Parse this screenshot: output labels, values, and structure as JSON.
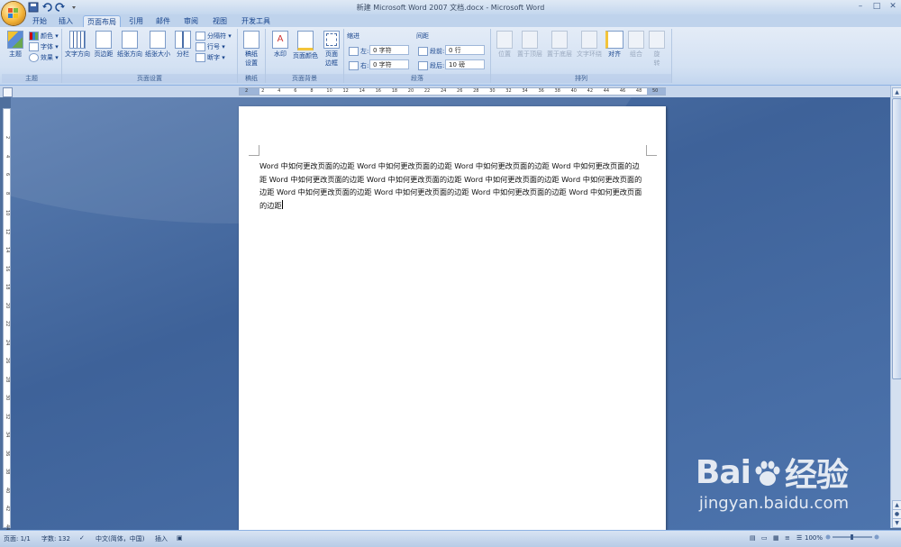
{
  "window": {
    "title": "新建 Microsoft Word 2007 文档.docx - Microsoft Word",
    "controls": [
      "–",
      "□",
      "✕"
    ]
  },
  "tabs": [
    "开始",
    "插入",
    "页面布局",
    "引用",
    "邮件",
    "审阅",
    "视图",
    "开发工具"
  ],
  "active_tab": "页面布局",
  "ribbon": {
    "theme_group": {
      "label": "主题",
      "theme_button": "主题",
      "colors": "颜色 ▾",
      "fonts": "字体 ▾",
      "effects": "效果 ▾"
    },
    "page_setup": {
      "label": "页面设置",
      "text_direction": "文字方向",
      "margins": "页边距",
      "orientation": "纸张方向",
      "size": "纸张大小",
      "columns": "分栏",
      "breaks": "分隔符 ▾",
      "line_numbers": "行号 ▾",
      "hyphenation": "断字 ▾"
    },
    "draft": {
      "label": "稿纸",
      "draft_settings_line1": "稿纸",
      "draft_settings_line2": "设置"
    },
    "page_background": {
      "label": "页面背景",
      "watermark": "水印",
      "page_color": "页面颜色",
      "page_borders_line1": "页面",
      "page_borders_line2": "边框"
    },
    "paragraph": {
      "label": "段落",
      "indent_title": "缩进",
      "indent_left_label": "左:",
      "indent_left_value": "0 字符",
      "indent_right_label": "右:",
      "indent_right_value": "0 字符",
      "spacing_title": "间距",
      "spacing_before_label": "段前:",
      "spacing_before_value": "0 行",
      "spacing_after_label": "段后:",
      "spacing_after_value": "10 磅"
    },
    "arrange": {
      "label": "排列",
      "position": "位置",
      "bring_front": "置于顶层",
      "send_back": "置于底层",
      "text_wrap": "文字环绕",
      "align": "对齐",
      "group": "组合",
      "rotate_line1": "旋",
      "rotate_line2": "转"
    }
  },
  "ruler": {
    "ticks": [
      "2",
      "2",
      "4",
      "6",
      "8",
      "10",
      "12",
      "14",
      "16",
      "18",
      "20",
      "22",
      "24",
      "26",
      "28",
      "30",
      "32",
      "34",
      "36",
      "38",
      "40",
      "42",
      "44",
      "46",
      "48",
      "50"
    ],
    "vticks": [
      "2",
      "4",
      "6",
      "8",
      "10",
      "12",
      "14",
      "16",
      "18",
      "20",
      "22",
      "24",
      "26",
      "28",
      "30",
      "32",
      "34",
      "36",
      "38",
      "40",
      "42",
      "44"
    ]
  },
  "document": {
    "body_text": "Word 中如何更改页面的边距 Word 中如何更改页面的边距 Word 中如何更改页面的边距 Word 中如何更改页面的边距 Word 中如何更改页面的边距 Word 中如何更改页面的边距 Word 中如何更改页面的边距 Word 中如何更改页面的边距 Word 中如何更改页面的边距 Word 中如何更改页面的边距 Word 中如何更改页面的边距 Word 中如何更改页面的边距"
  },
  "statusbar": {
    "page": "页面: 1/1",
    "words": "字数: 132",
    "language": "中文(简体，中国)",
    "mode": "插入",
    "zoom": "100%"
  },
  "watermark": {
    "brand_a": "Bai",
    "brand_b": "经验",
    "url": "jingyan.baidu.com"
  },
  "colors": {
    "ribbon_text": "#15428b",
    "workspace": "#4a6fa5",
    "office_orb": "#f3b43a"
  }
}
